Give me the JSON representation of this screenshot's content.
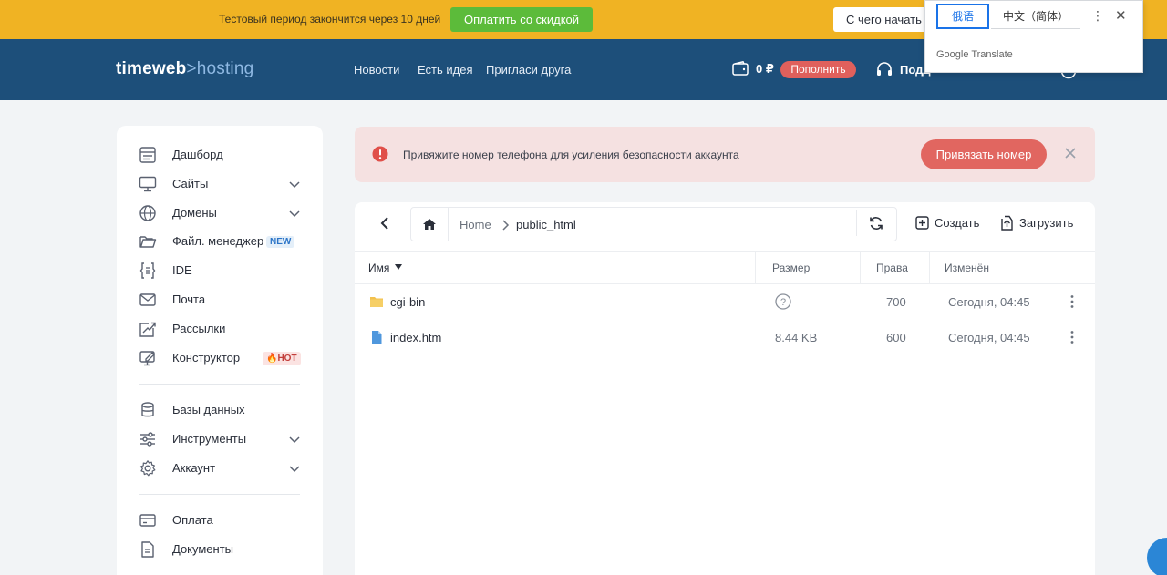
{
  "trial_banner": {
    "text": "Тестовый период закончится через 10 дней",
    "pay_button": "Оплатить со скидкой",
    "start_button": "С чего начать"
  },
  "translate_popup": {
    "tab_source": "俄语",
    "tab_target": "中文（简体）",
    "brand": "Google Translate",
    "more_icon": "more-vertical-icon",
    "close_icon": "close-icon"
  },
  "header": {
    "logo_part1": "timeweb",
    "logo_arrow": ">",
    "logo_part2": "hosting",
    "nav": [
      "Новости",
      "Есть идея",
      "Пригласи друга"
    ],
    "balance": "0 ₽",
    "topup_button": "Пополнить",
    "support_label": "Подд"
  },
  "sidebar": {
    "items": [
      {
        "label": "Дашборд",
        "icon": "dashboard-icon"
      },
      {
        "label": "Сайты",
        "icon": "monitor-icon",
        "chevron": true
      },
      {
        "label": "Домены",
        "icon": "globe-icon",
        "chevron": true
      },
      {
        "label": "Файл. менеджер",
        "icon": "folder-icon",
        "badge": "NEW"
      },
      {
        "label": "IDE",
        "icon": "ide-icon"
      },
      {
        "label": "Почта",
        "icon": "mail-icon"
      },
      {
        "label": "Рассылки",
        "icon": "send-icon"
      },
      {
        "label": "Конструктор",
        "icon": "builder-icon",
        "badge": "🔥HOT"
      },
      {
        "label": "Базы данных",
        "icon": "database-icon"
      },
      {
        "label": "Инструменты",
        "icon": "sliders-icon",
        "chevron": true
      },
      {
        "label": "Аккаунт",
        "icon": "gear-icon",
        "chevron": true
      },
      {
        "label": "Оплата",
        "icon": "card-icon"
      },
      {
        "label": "Документы",
        "icon": "document-icon"
      }
    ]
  },
  "alert": {
    "text": "Привяжите номер телефона для усиления безопасности аккаунта",
    "button": "Привязать номер"
  },
  "file_manager": {
    "breadcrumb_home": "Home",
    "breadcrumb_current": "public_html",
    "create_label": "Создать",
    "upload_label": "Загрузить",
    "columns": {
      "name": "Имя",
      "size": "Размер",
      "perms": "Права",
      "modified": "Изменён"
    },
    "rows": [
      {
        "name": "cgi-bin",
        "type": "folder",
        "size": "?",
        "perms": "700",
        "modified": "Сегодня, 04:45"
      },
      {
        "name": "index.htm",
        "type": "file",
        "size": "8.44 KB",
        "perms": "600",
        "modified": "Сегодня, 04:45"
      }
    ]
  },
  "colors": {
    "banner": "#f0b323",
    "header": "#1d4f7a",
    "accent_red": "#e16660",
    "pay_green": "#5cbb3a",
    "link_blue": "#2b74c7"
  }
}
